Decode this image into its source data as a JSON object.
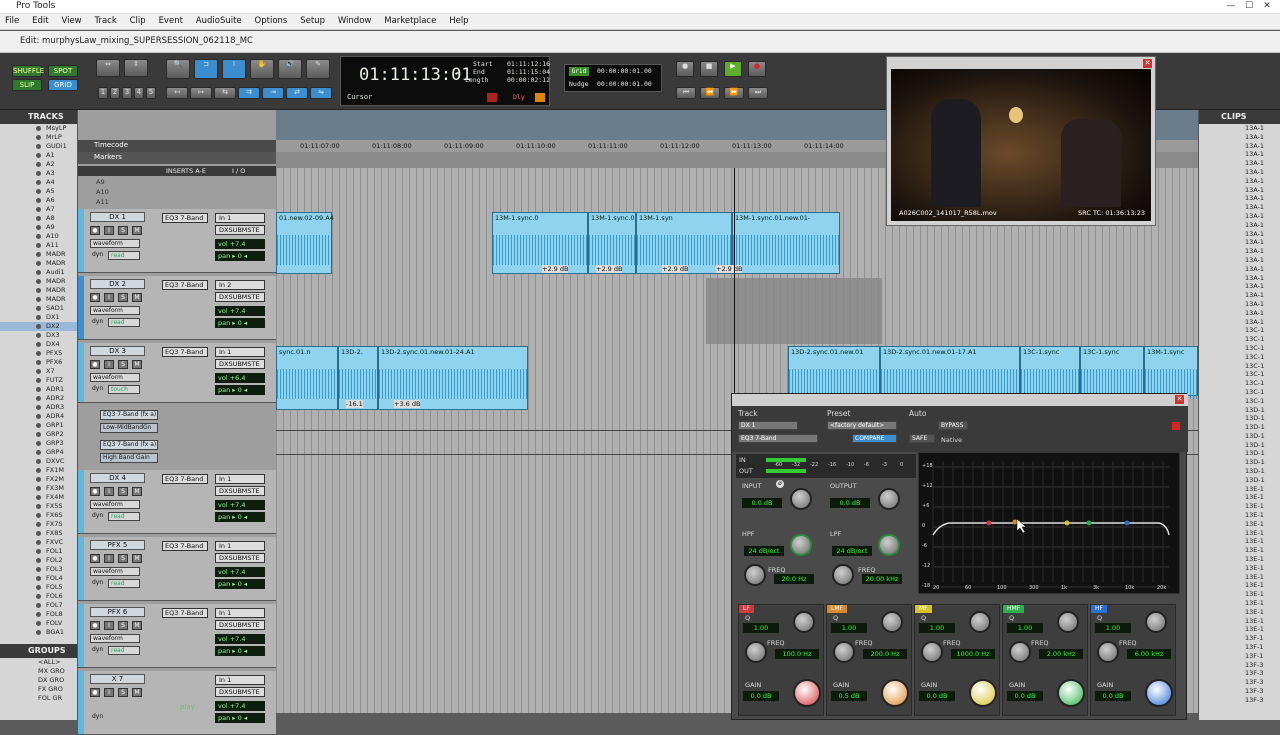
{
  "app": {
    "title": "Pro Tools",
    "window_controls": {
      "min": "—",
      "max": "☐",
      "close": "✕"
    }
  },
  "menu": [
    "File",
    "Edit",
    "View",
    "Track",
    "Clip",
    "Event",
    "AudioSuite",
    "Options",
    "Setup",
    "Window",
    "Marketplace",
    "Help"
  ],
  "edit_window": {
    "title": "Edit: murphysLaw_mixing_SUPERSESSION_062118_MC"
  },
  "toolbar": {
    "modes": [
      "SHUFFLE",
      "SPOT",
      "SLIP",
      "GRID"
    ],
    "counters": [
      "1",
      "2",
      "3",
      "4",
      "5"
    ],
    "main_counter": "01:11:13:01",
    "cursor_label": "Cursor",
    "start_label": "Start",
    "end_label": "End",
    "length_label": "Length",
    "start": "01:11:12:16",
    "end": "01:11:15:04",
    "length": "00:00:02:12",
    "dly": "Dly",
    "grid_label": "Grid",
    "grid_value": "00:00:00:01.00",
    "nudge_label": "Nudge",
    "nudge_value": "00:00:00:01.00"
  },
  "tracks_panel": {
    "title": "TRACKS",
    "items": [
      "MsyLP",
      "MrLP",
      "GUDi1",
      "A1",
      "A2",
      "A3",
      "A4",
      "A5",
      "A6",
      "A7",
      "A8",
      "A9",
      "A10",
      "A11",
      "MADR",
      "MADR",
      "Audi1",
      "MADR",
      "MADR",
      "MADR",
      "SAD1",
      "DX1",
      "DX2",
      "DX3",
      "DX4",
      "PFX5",
      "PFX6",
      "X7",
      "FUTZ",
      "ADR1",
      "ADR2",
      "ADR3",
      "ADR4",
      "GRP1",
      "GRP2",
      "GRP3",
      "GRP4",
      "DXVC",
      "FX1M",
      "FX2M",
      "FX3M",
      "FX4M",
      "FX5S",
      "FX6S",
      "FX7S",
      "FX8S",
      "FXVC",
      "FOL1",
      "FOL2",
      "FOL3",
      "FOL4",
      "FOL5",
      "FOL6",
      "FOL7",
      "FOL8",
      "FOLV",
      "BGA1"
    ]
  },
  "groups_panel": {
    "title": "GROUPS",
    "items": [
      "<ALL>",
      "MX GRO",
      "DX GRO",
      "FX GRO",
      "FOL GR"
    ]
  },
  "clips_panel": {
    "title": "CLIPS",
    "items": [
      "13A-1",
      "13A-1",
      "13A-1",
      "13A-1",
      "13A-1",
      "13A-1",
      "13A-1",
      "13A-1",
      "13A-1",
      "13A-1",
      "13A-1",
      "13A-1",
      "13A-1",
      "13A-1",
      "13A-1",
      "13A-1",
      "13A-1",
      "13A-1",
      "13A-1",
      "13A-1",
      "13A-1",
      "13A-1",
      "13A-1",
      "13C-1",
      "13C-1",
      "13C-1",
      "13C-1",
      "13C-1",
      "13C-1",
      "13C-1",
      "13C-1",
      "13C-1",
      "13D-1",
      "13D-1",
      "13D-1",
      "13D-1",
      "13D-1",
      "13D-1",
      "13D-1",
      "13D-1",
      "13D-1",
      "13E-1",
      "13E-1",
      "13E-1",
      "13E-1",
      "13E-1",
      "13E-1",
      "13E-1",
      "13E-1",
      "13E-1",
      "13E-1",
      "13E-1",
      "13E-1",
      "13E-1",
      "13E-1",
      "13E-1",
      "13E-1",
      "13E-1",
      "13F-1",
      "13F-1",
      "13F-1",
      "13F-3",
      "13F-3",
      "13F-3",
      "13F-3",
      "13F-3"
    ]
  },
  "ruler": {
    "timecode_label": "Timecode",
    "markers_label": "Markers",
    "ticks": [
      "01:11:07:00",
      "01:11:08:00",
      "01:11:09:00",
      "01:11:10:00",
      "01:11:11:00",
      "01:11:12:00",
      "01:11:13:00",
      "01:11:14:00"
    ],
    "subtracks": [
      "A9",
      "A10",
      "A11"
    ]
  },
  "mix_headers": {
    "inserts": "INSERTS A-E",
    "io": "I / O"
  },
  "track_headers": [
    {
      "name": "DX 1",
      "insert": "EQ3 7-Band",
      "input": "In 1",
      "output": "DXSUBMSTE",
      "vol": "vol  +7.4",
      "pan": "pan  ▸ 0 ◂",
      "view": "waveform",
      "auto": "read"
    },
    {
      "name": "DX 2",
      "insert": "EQ3 7-Band",
      "input": "In 2",
      "output": "DXSUBMSTE",
      "vol": "vol  +7.4",
      "pan": "pan  ▸ 0 ◂",
      "view": "waveform",
      "auto": "read"
    },
    {
      "name": "DX 3",
      "insert": "EQ3 7-Band",
      "input": "In 1",
      "output": "DXSUBMSTE",
      "vol": "vol  +6.4",
      "pan": "pan  ▸ 0 ◂",
      "view": "waveform",
      "auto": "touch"
    },
    {
      "name": "DX 4",
      "insert": "EQ3 7-Band",
      "input": "In 1",
      "output": "DXSUBMSTE",
      "vol": "vol  +7.4",
      "pan": "pan  ▸ 0 ◂",
      "view": "waveform",
      "auto": "read"
    },
    {
      "name": "PFX 5",
      "insert": "EQ3 7-Band",
      "input": "In 1",
      "output": "DXSUBMSTE",
      "vol": "vol  +7.4",
      "pan": "pan  ▸ 0 ◂",
      "view": "waveform",
      "auto": "read"
    },
    {
      "name": "PFX 6",
      "insert": "EQ3 7-Band",
      "input": "In 1",
      "output": "DXSUBMSTE",
      "vol": "vol  +7.4",
      "pan": "pan  ▸ 0 ◂",
      "view": "waveform",
      "auto": "read"
    },
    {
      "name": "X 7",
      "insert": "",
      "input": "In 1",
      "output": "DXSUBMSTE",
      "vol": "vol  +7.4",
      "pan": "pan  ▸ 0 ◂",
      "view": "",
      "auto": ""
    }
  ],
  "automation_lanes": [
    "EQ3 7-Band (fx a)",
    "Low-MidBandGn",
    "EQ3 7-Band (fx a)",
    "High Band Gain"
  ],
  "dyn_label": "dyn",
  "clips_timeline": [
    {
      "label": "01.new.02-09.A4"
    },
    {
      "label": "13M-1.sync.0"
    },
    {
      "label": "13M-1.sync.0"
    },
    {
      "label": "13M-1.syn"
    },
    {
      "label": "13M-1.sync.01.new.01-"
    },
    {
      "label": "sync.01.n"
    },
    {
      "label": "13D-2."
    },
    {
      "label": "13D-2.sync.01.new.01-24.A1"
    },
    {
      "label": "13D-2.sync.01.new.01"
    },
    {
      "label": "13D-2.sync.01.new.01-17.A1"
    },
    {
      "label": "13C-1.sync"
    },
    {
      "label": "13C-1.sync"
    },
    {
      "label": "13M-1.sync"
    }
  ],
  "clip_gains": [
    "+2.9 dB",
    "+2.9 dB",
    "+2.9 dB",
    "+2.9 dB",
    "-16.1",
    "+3.6 dB"
  ],
  "video": {
    "filename": "A026C002_141017_R58L.mov",
    "src_tc": "SRC TC: 01:36:13:23"
  },
  "eq_plugin": {
    "track_label": "Track",
    "preset_label": "Preset",
    "auto_label": "Auto",
    "track_name": "DX 1",
    "plugin_name": "EQ3 7-Band",
    "preset_name": "<factory default>",
    "compare": "COMPARE",
    "bypass": "BYPASS",
    "safe": "SAFE",
    "native": "Native",
    "in_label": "IN",
    "out_label": "OUT",
    "input_label": "INPUT",
    "output_label": "OUTPUT",
    "input_value": "0.0 dB",
    "output_value": "0.0 dB",
    "hpf_label": "HPF",
    "lpf_label": "LPF",
    "hpf_slope": "24 dB/oct",
    "lpf_slope": "24 dB/oct",
    "hpf_freq": "20.0 Hz",
    "lpf_freq": "20.00 kHz",
    "freq_label": "FREQ",
    "meter_ticks": [
      "-60",
      "-32",
      "-22",
      "-16",
      "-10",
      "-6",
      "-3",
      "0"
    ],
    "bands": [
      {
        "name": "LF",
        "q": "1.00",
        "freq": "100.0 Hz",
        "gain": "0.0 dB",
        "color": "#d23a3a"
      },
      {
        "name": "LMF",
        "q": "1.00",
        "freq": "200.0 Hz",
        "gain": "0.5 dB",
        "color": "#d98a2a"
      },
      {
        "name": "MF",
        "q": "1.00",
        "freq": "1000.0 Hz",
        "gain": "0.0 dB",
        "color": "#d8c12a"
      },
      {
        "name": "HMF",
        "q": "1.00",
        "freq": "2.00 kHz",
        "gain": "0.0 dB",
        "color": "#2fb04a"
      },
      {
        "name": "HF",
        "q": "1.00",
        "freq": "6.00 kHz",
        "gain": "0.0 dB",
        "color": "#2a6fd8"
      }
    ],
    "q_label": "Q",
    "gain_label": "GAIN",
    "graph_y": [
      "+18",
      "+12",
      "+6",
      "0",
      "-6",
      "-12",
      "-18"
    ],
    "graph_x": [
      "20",
      "60",
      "100",
      "300",
      "1k",
      "3k",
      "10k",
      "20k"
    ]
  },
  "status": {
    "play": "play"
  }
}
